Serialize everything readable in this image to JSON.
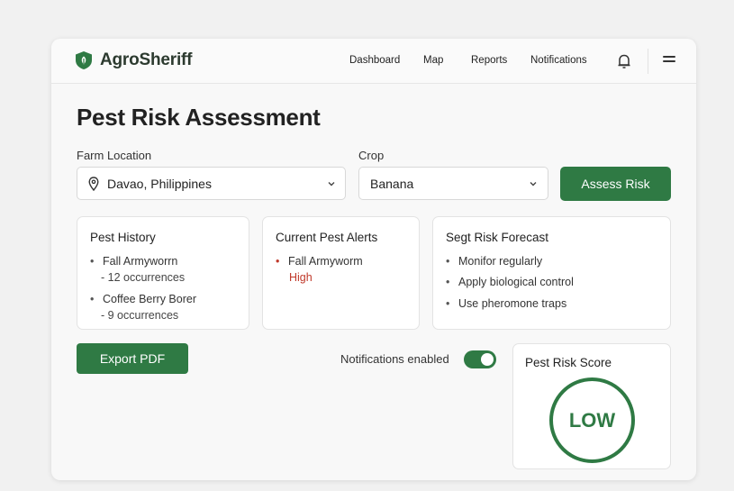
{
  "colors": {
    "accent": "#2f7a44",
    "alert": "#c0392b"
  },
  "header": {
    "brand": "AgroSheriff",
    "logo_icon": "shield-leaf-icon",
    "nav": [
      "Dashboard",
      "Map",
      "Reports",
      "Notifications"
    ],
    "bell_icon": "bell-icon",
    "menu_icon": "hamburger-menu-icon"
  },
  "page": {
    "title": "Pest Risk Assessment"
  },
  "form": {
    "location_label": "Farm Location",
    "location_value": "Davao, Philippines",
    "location_icon": "map-pin-icon",
    "crop_label": "Crop",
    "crop_value": "Banana",
    "assess_button": "Assess Risk"
  },
  "panels": {
    "history": {
      "title": "Pest History",
      "items": [
        {
          "name": "Fall Armyworrn",
          "detail": "- 12 occurrences"
        },
        {
          "name": "Coffee Berry Borer",
          "detail": "- 9 occurrences"
        }
      ]
    },
    "alerts": {
      "title": "Current Pest Alerts",
      "items": [
        {
          "name": "Fall Armyworm",
          "level": "High"
        }
      ]
    },
    "forecast": {
      "title": "Segt Risk Forecast",
      "items": [
        "Monifor regularly",
        "Apply biological control",
        "Use pheromone traps"
      ]
    }
  },
  "actions": {
    "export_button": "Export PDF",
    "notifications_label": "Notifications enabled",
    "notifications_enabled": true
  },
  "score": {
    "title": "Pest Risk Score",
    "value": "LOW"
  }
}
